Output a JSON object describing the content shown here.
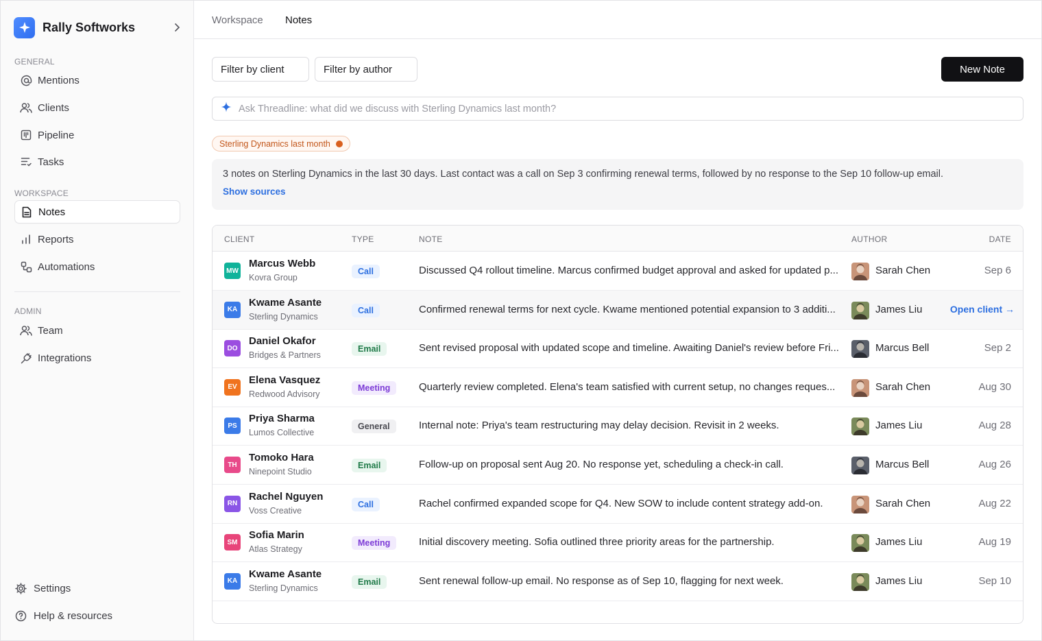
{
  "sidebar": {
    "brand": "Rally Softworks",
    "general_label": "GENERAL",
    "workspace_label": "WORKSPACE",
    "admin_label": "ADMIN",
    "general": [
      {
        "label": "Mentions",
        "icon": "at-icon"
      },
      {
        "label": "Clients",
        "icon": "users-icon"
      },
      {
        "label": "Pipeline",
        "icon": "pipeline-icon"
      },
      {
        "label": "Tasks",
        "icon": "tasks-icon"
      }
    ],
    "workspace": [
      {
        "label": "Notes",
        "icon": "document-icon"
      },
      {
        "label": "Reports",
        "icon": "bar-chart-icon"
      },
      {
        "label": "Automations",
        "icon": "automation-icon"
      }
    ],
    "admin": [
      {
        "label": "Team",
        "icon": "users-icon"
      },
      {
        "label": "Integrations",
        "icon": "plug-icon"
      }
    ],
    "settings": "Settings",
    "help": "Help & resources"
  },
  "topbar": {
    "crumbs": [
      "Workspace",
      "Notes"
    ]
  },
  "toolbar": {
    "filter_client": "Filter by client",
    "filter_author": "Filter by author",
    "new_note": "New Note"
  },
  "ask": {
    "placeholder": "Ask Threadline: what did we discuss with Sterling Dynamics last month?"
  },
  "chip": {
    "label": "Sterling Dynamics last month",
    "color": "#d9601f"
  },
  "summary": {
    "text": "3 notes on Sterling Dynamics in the last 30 days. Last contact was a call on Sep 3 confirming renewal terms, followed by no response to the Sep 10 follow-up email.",
    "show_sources": "Show sources"
  },
  "table": {
    "headers": {
      "client": "CLIENT",
      "type": "TYPE",
      "note": "NOTE",
      "author": "AUTHOR",
      "date": "DATE"
    },
    "open_client": "Open client →",
    "rows": [
      {
        "initials": "MW",
        "color": "#10b39a",
        "name": "Marcus Webb",
        "company": "Kovra Group",
        "type": "Call",
        "note": "Discussed Q4 rollout timeline. Marcus confirmed budget approval and asked for updated p...",
        "author": "Sarah Chen",
        "date": "Sep 6"
      },
      {
        "initials": "KA",
        "color": "#3b7be8",
        "name": "Kwame Asante",
        "company": "Sterling Dynamics",
        "type": "Call",
        "note": "Confirmed renewal terms for next cycle. Kwame mentioned potential expansion to 3 additi...",
        "author": "James Liu",
        "date": ""
      },
      {
        "initials": "DO",
        "color": "#9b4de0",
        "name": "Daniel Okafor",
        "company": "Bridges & Partners",
        "type": "Email",
        "note": "Sent revised proposal with updated scope and timeline. Awaiting Daniel's review before Fri...",
        "author": "Marcus Bell",
        "date": "Sep 2"
      },
      {
        "initials": "EV",
        "color": "#f0731e",
        "name": "Elena Vasquez",
        "company": "Redwood Advisory",
        "type": "Meeting",
        "note": "Quarterly review completed. Elena's team satisfied with current setup, no changes reques...",
        "author": "Sarah Chen",
        "date": "Aug 30"
      },
      {
        "initials": "PS",
        "color": "#3b7be8",
        "name": "Priya Sharma",
        "company": "Lumos Collective",
        "type": "General",
        "note": "Internal note: Priya's team restructuring may delay decision. Revisit in 2 weeks.",
        "author": "James Liu",
        "date": "Aug 28"
      },
      {
        "initials": "TH",
        "color": "#e84a8a",
        "name": "Tomoko Hara",
        "company": "Ninepoint Studio",
        "type": "Email",
        "note": "Follow-up on proposal sent Aug 20. No response yet, scheduling a check-in call.",
        "author": "Marcus Bell",
        "date": "Aug 26"
      },
      {
        "initials": "RN",
        "color": "#8a55e6",
        "name": "Rachel Nguyen",
        "company": "Voss Creative",
        "type": "Call",
        "note": "Rachel confirmed expanded scope for Q4. New SOW to include content strategy add-on.",
        "author": "Sarah Chen",
        "date": "Aug 22"
      },
      {
        "initials": "SM",
        "color": "#e8457a",
        "name": "Sofia Marin",
        "company": "Atlas Strategy",
        "type": "Meeting",
        "note": "Initial discovery meeting. Sofia outlined three priority areas for the partnership.",
        "author": "James Liu",
        "date": "Aug 19"
      },
      {
        "initials": "KA",
        "color": "#3b7be8",
        "name": "Kwame Asante",
        "company": "Sterling Dynamics",
        "type": "Email",
        "note": "Sent renewal follow-up email. No response as of Sep 10, flagging for next week.",
        "author": "James Liu",
        "date": "Sep 10"
      }
    ]
  }
}
